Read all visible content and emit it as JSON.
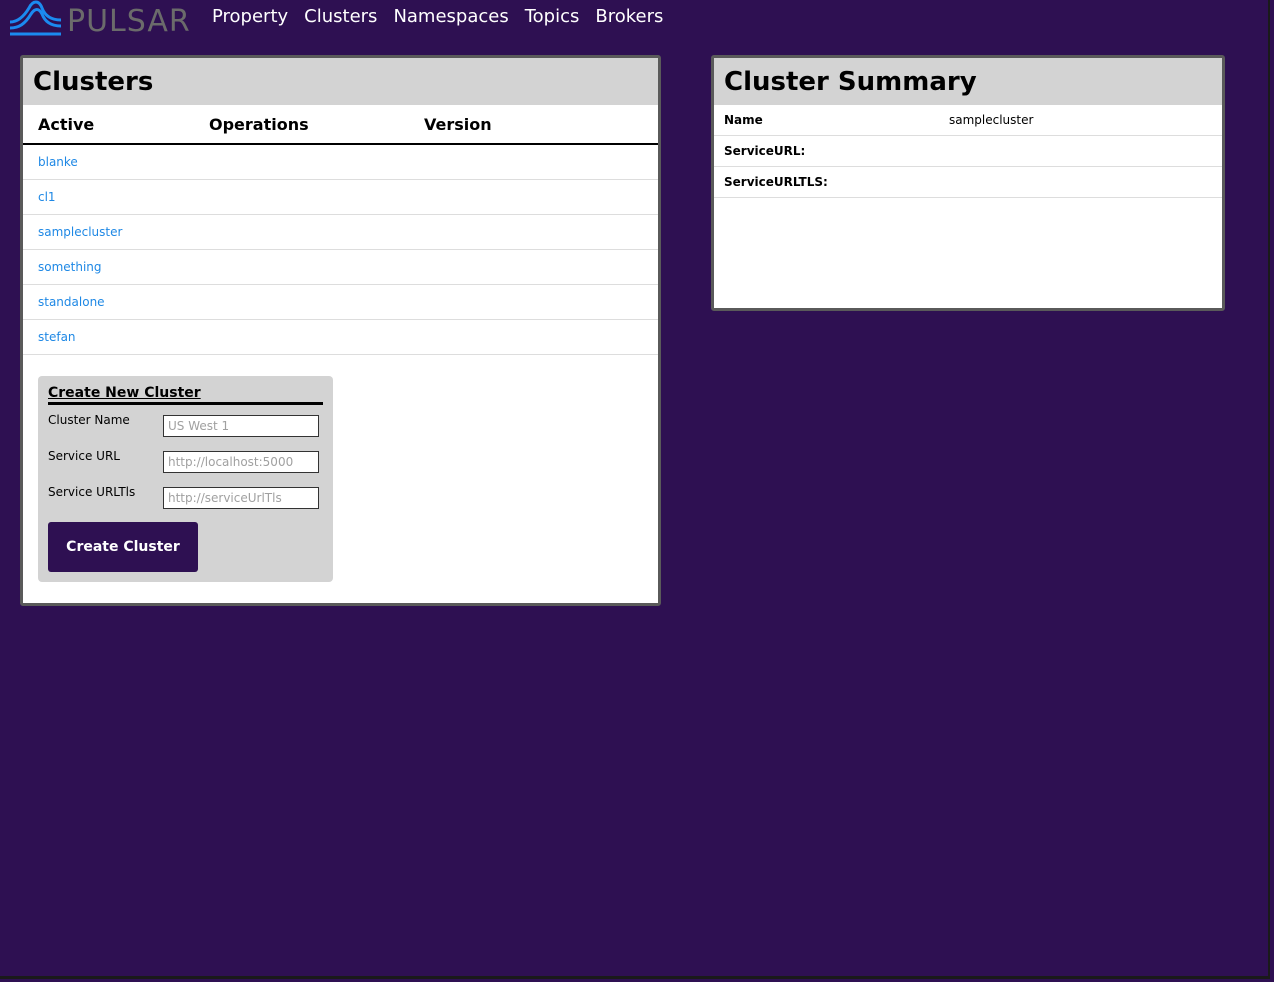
{
  "brand": {
    "logo_text": "PULSAR"
  },
  "nav": {
    "items": [
      {
        "label": "Property"
      },
      {
        "label": "Clusters"
      },
      {
        "label": "Namespaces"
      },
      {
        "label": "Topics"
      },
      {
        "label": "Brokers"
      }
    ]
  },
  "clusters_panel": {
    "title": "Clusters",
    "columns": [
      "Active",
      "Operations",
      "Version"
    ],
    "rows": [
      {
        "name": "blanke"
      },
      {
        "name": "cl1"
      },
      {
        "name": "samplecluster"
      },
      {
        "name": "something"
      },
      {
        "name": "standalone"
      },
      {
        "name": "stefan"
      }
    ]
  },
  "create_form": {
    "title": "Create New Cluster",
    "fields": [
      {
        "label": "Cluster Name",
        "value": "",
        "placeholder": "US West 1"
      },
      {
        "label": "Service URL",
        "value": "",
        "placeholder": "http://localhost:5000"
      },
      {
        "label": "Service URLTls",
        "value": "",
        "placeholder": "http://serviceUrlTls"
      }
    ],
    "submit_label": "Create Cluster"
  },
  "summary_panel": {
    "title": "Cluster Summary",
    "rows": [
      {
        "key": "Name",
        "value": "samplecluster"
      },
      {
        "key": "ServiceURL:",
        "value": ""
      },
      {
        "key": "ServiceURLTLS:",
        "value": ""
      }
    ]
  },
  "colors": {
    "background": "#2e1052",
    "panel_header": "#d3d3d3",
    "link": "#1e88e5",
    "logo_blue": "#1b8af0",
    "logo_gray": "#6b6b6b",
    "button": "#2e1052"
  }
}
